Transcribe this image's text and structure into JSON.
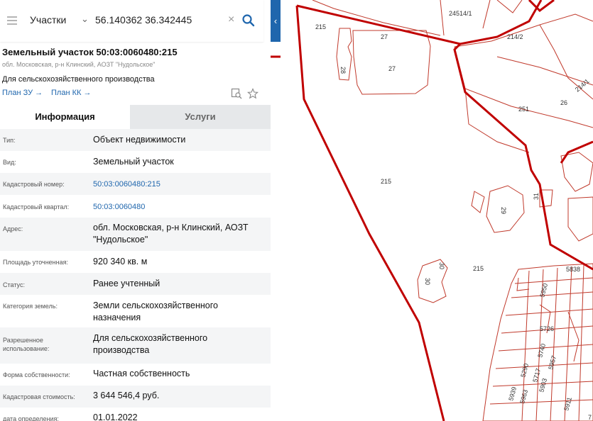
{
  "search": {
    "layer": "Участки",
    "query": "56.140362 36.342445"
  },
  "parcel": {
    "title": "Земельный участок 50:03:0060480:215",
    "address_short": "обл. Московская, р-н Клинский, АОЗТ \"Нудольское\"",
    "purpose": "Для сельскохозяйственного производства",
    "plan_zu": "План ЗУ →",
    "plan_kk": "План КК →"
  },
  "tabs": {
    "info": "Информация",
    "services": "Услуги"
  },
  "rows": [
    {
      "label": "Тип:",
      "value": "Объект недвижимости"
    },
    {
      "label": "Вид:",
      "value": "Земельный участок"
    },
    {
      "label": "Кадастровый номер:",
      "value": "50:03:0060480:215"
    },
    {
      "label": "Кадастровый квартал:",
      "value": "50:03:0060480"
    },
    {
      "label": "Адрес:",
      "value": "обл. Московская, р-н Клинский, АОЗТ \"Нудольское\""
    },
    {
      "label": "Площадь уточненная:",
      "value": "920 340 кв. м"
    },
    {
      "label": "Статус:",
      "value": "Ранее учтенный"
    },
    {
      "label": "Категория земель:",
      "value": "Земли сельскохозяйственного назначения"
    },
    {
      "label": "Разрешенное использование:",
      "value": "Для сельскохозяйственного производства"
    },
    {
      "label": "Форма собственности:",
      "value": "Частная собственность"
    },
    {
      "label": "Кадастровая стоимость:",
      "value": "3 644 546,4 руб."
    },
    {
      "label": "дата определения:",
      "value": "01.01.2022"
    }
  ],
  "map_labels": {
    "l215a": "215",
    "l215b": "215",
    "l215c": "215",
    "l27a": "27",
    "l27b": "27",
    "l28": "28",
    "l24514": "24514/1",
    "l2142": "214/2",
    "l2141": "214/1",
    "l251": "251",
    "l26": "26",
    "l29": "29",
    "l31": "31",
    "l30a": "30",
    "l30b": "30",
    "l5838": "5838",
    "l5726": "5726",
    "l5950": "5950",
    "l5740": "5740",
    "l5290": "5290",
    "l5717": "5717",
    "l5957": "5957",
    "l5903": "5903",
    "l5939": "5939",
    "l5963": "5963",
    "l5911": "5911",
    "l7": "7"
  },
  "colors": {
    "accent": "#1f66ad",
    "boundary": "#c00000",
    "parcel_line": "#c0392b"
  }
}
